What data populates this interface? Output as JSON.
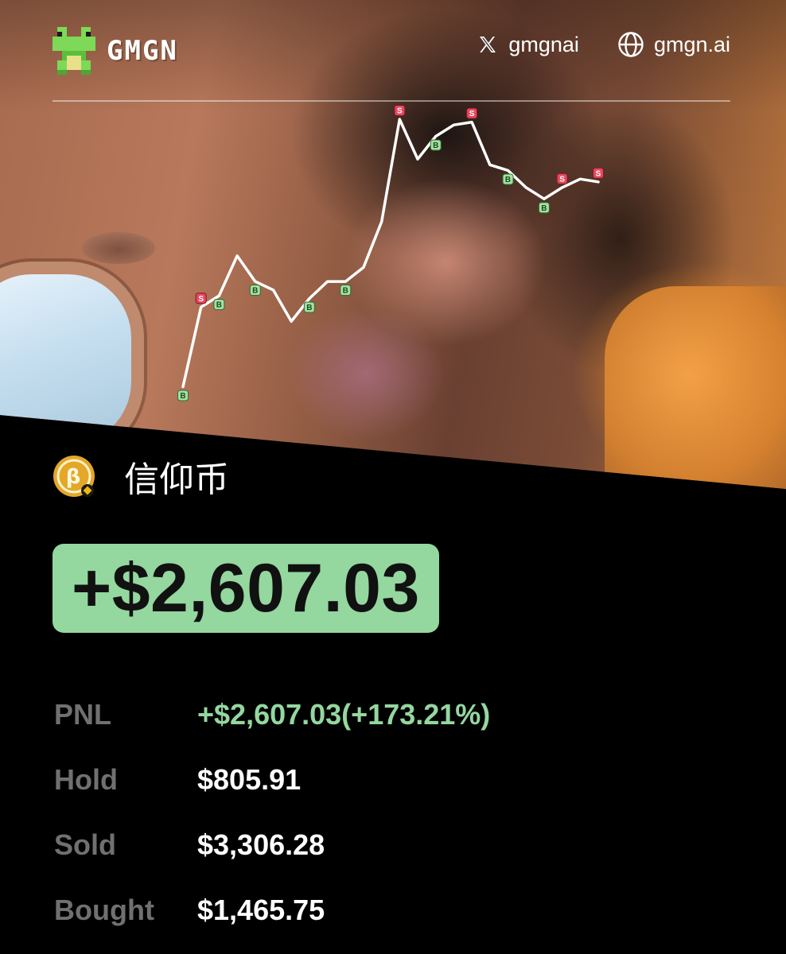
{
  "header": {
    "brand_name": "GMGN",
    "twitter_handle": "gmgnai",
    "website": "gmgn.ai"
  },
  "token": {
    "name": "信仰币",
    "logo_letter": "β"
  },
  "summary": {
    "pnl_amount": "+$2,607.03"
  },
  "stats": [
    {
      "label": "PNL",
      "value": "+$2,607.03(+173.21%)",
      "tone": "positive"
    },
    {
      "label": "Hold",
      "value": "$805.91",
      "tone": "neutral"
    },
    {
      "label": "Sold",
      "value": "$3,306.28",
      "tone": "neutral"
    },
    {
      "label": "Bought",
      "value": "$1,465.75",
      "tone": "neutral"
    }
  ],
  "colors": {
    "profit_green": "#94d79f",
    "buy_marker": "#a3e0a3",
    "sell_marker": "#e8475e",
    "background": "#000000",
    "label_gray": "#707070"
  },
  "icons": {
    "brand": "frog-logo-icon",
    "twitter": "x-icon",
    "website": "globe-icon",
    "token": "token-logo-icon"
  },
  "chart_data": {
    "type": "line",
    "y_trend_relative": [
      0.06,
      0.34,
      0.38,
      0.52,
      0.43,
      0.4,
      0.29,
      0.37,
      0.43,
      0.43,
      0.48,
      0.64,
      1.0,
      0.86,
      0.94,
      0.98,
      0.99,
      0.84,
      0.82,
      0.76,
      0.72,
      0.76,
      0.79,
      0.78
    ],
    "trades": [
      {
        "point": 0,
        "side": "B"
      },
      {
        "point": 1,
        "side": "S"
      },
      {
        "point": 2,
        "side": "B"
      },
      {
        "point": 4,
        "side": "B"
      },
      {
        "point": 7,
        "side": "B"
      },
      {
        "point": 9,
        "side": "B"
      },
      {
        "point": 12,
        "side": "S"
      },
      {
        "point": 14,
        "side": "B"
      },
      {
        "point": 16,
        "side": "S"
      },
      {
        "point": 18,
        "side": "B"
      },
      {
        "point": 20,
        "side": "B"
      },
      {
        "point": 21,
        "side": "S"
      },
      {
        "point": 23,
        "side": "S"
      }
    ],
    "labels": {
      "buy": "B",
      "sell": "S"
    }
  }
}
